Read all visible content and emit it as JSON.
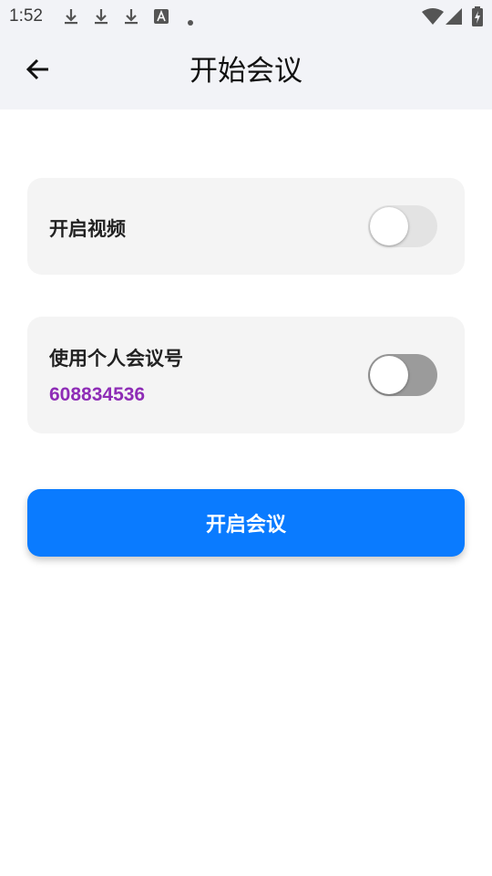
{
  "status_bar": {
    "time": "1:52",
    "notification_icons": [
      "download-icon",
      "download-icon",
      "download-icon",
      "font-a-icon",
      "dot-icon"
    ],
    "system_icons": [
      "wifi-icon",
      "signal-icon",
      "battery-charging-icon"
    ]
  },
  "app_bar": {
    "back_icon": "arrow-left-icon",
    "title": "开始会议"
  },
  "settings": {
    "video": {
      "label": "开启视频",
      "enabled": false
    },
    "personal_meeting": {
      "label": "使用个人会议号",
      "number": "608834536",
      "enabled": false
    }
  },
  "start_button": {
    "label": "开启会议"
  },
  "colors": {
    "accent": "#0a7bff",
    "meeting_number": "#8e2db6",
    "header_bg": "#f2f3f7",
    "card_bg": "#f4f4f4"
  }
}
